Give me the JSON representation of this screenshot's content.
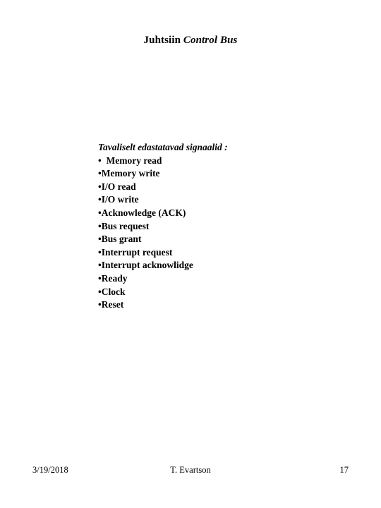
{
  "slide": {
    "title": {
      "bold_part": "Juhtsiin",
      "italic_part": "Control Bus"
    },
    "body": {
      "heading": "Tavaliselt edastatavad signaalid :",
      "bullets": [
        "•  Memory read",
        "•Memory write",
        "•I/O read",
        "•I/O write",
        "•Acknowledge (ACK)",
        "•Bus request",
        "•Bus grant",
        "•Interrupt request",
        "•Interrupt acknowlidge",
        "•Ready",
        "•Clock",
        "•Reset"
      ]
    },
    "footer": {
      "date": "3/19/2018",
      "author": "T. Evartson",
      "page_number": "17"
    },
    "colors": {
      "text": "#000000",
      "background": "#ffffff"
    }
  }
}
